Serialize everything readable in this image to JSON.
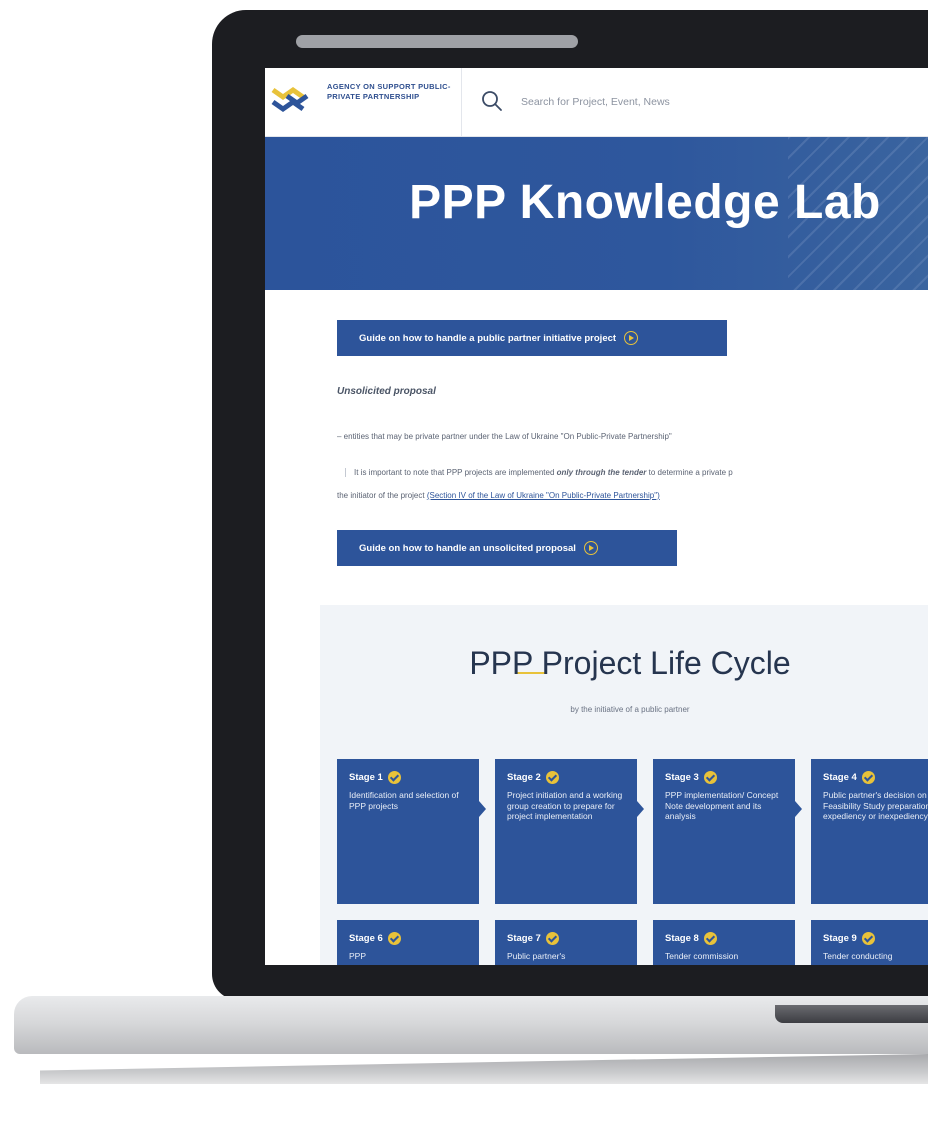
{
  "header": {
    "logo_text": "AGENCY ON SUPPORT PUBLIC-PRIVATE PARTNERSHIP",
    "search_placeholder": "Search for Project, Event, News"
  },
  "hero": {
    "title": "PPP Knowledge Lab"
  },
  "content": {
    "guide_public_button": "Guide on how to handle a public partner initiative project",
    "unsolicited_heading": "Unsolicited proposal",
    "note_entities": "– entities that may be private partner under the Law of Ukraine \"On Public-Private Partnership\"",
    "note_important_prefix": "It is important to note that PPP projects are implemented",
    "note_important_emphasis": "only through the tender",
    "note_important_suffix": "to determine a private p",
    "note_initiator_prefix": "the initiator of the project",
    "note_initiator_link": "(Section IV of the Law of Ukraine \"On Public-Private Partnership\")",
    "guide_unsolicited_button": "Guide on how to handle an unsolicited proposal"
  },
  "lifecycle": {
    "title": "PPP Project Life Cycle",
    "subtitle": "by the initiative of a public partner",
    "stages": [
      {
        "label": "Stage 1",
        "desc": "Identification and selection of PPP projects"
      },
      {
        "label": "Stage 2",
        "desc": "Project initiation and a working group creation to prepare for project implementation"
      },
      {
        "label": "Stage 3",
        "desc": "PPP implementation/ Concept Note development and its analysis"
      },
      {
        "label": "Stage 4",
        "desc": "Public partner's decision on the Feasibility Study preparation expediency or inexpediency"
      },
      {
        "label": "Stage 6",
        "desc": "PPP"
      },
      {
        "label": "Stage 7",
        "desc": "Public partner's"
      },
      {
        "label": "Stage 8",
        "desc": "Tender commission"
      },
      {
        "label": "Stage 9",
        "desc": "Tender conducting"
      }
    ]
  },
  "colors": {
    "brand_blue": "#2d549a",
    "accent_yellow": "#e8c23a"
  }
}
